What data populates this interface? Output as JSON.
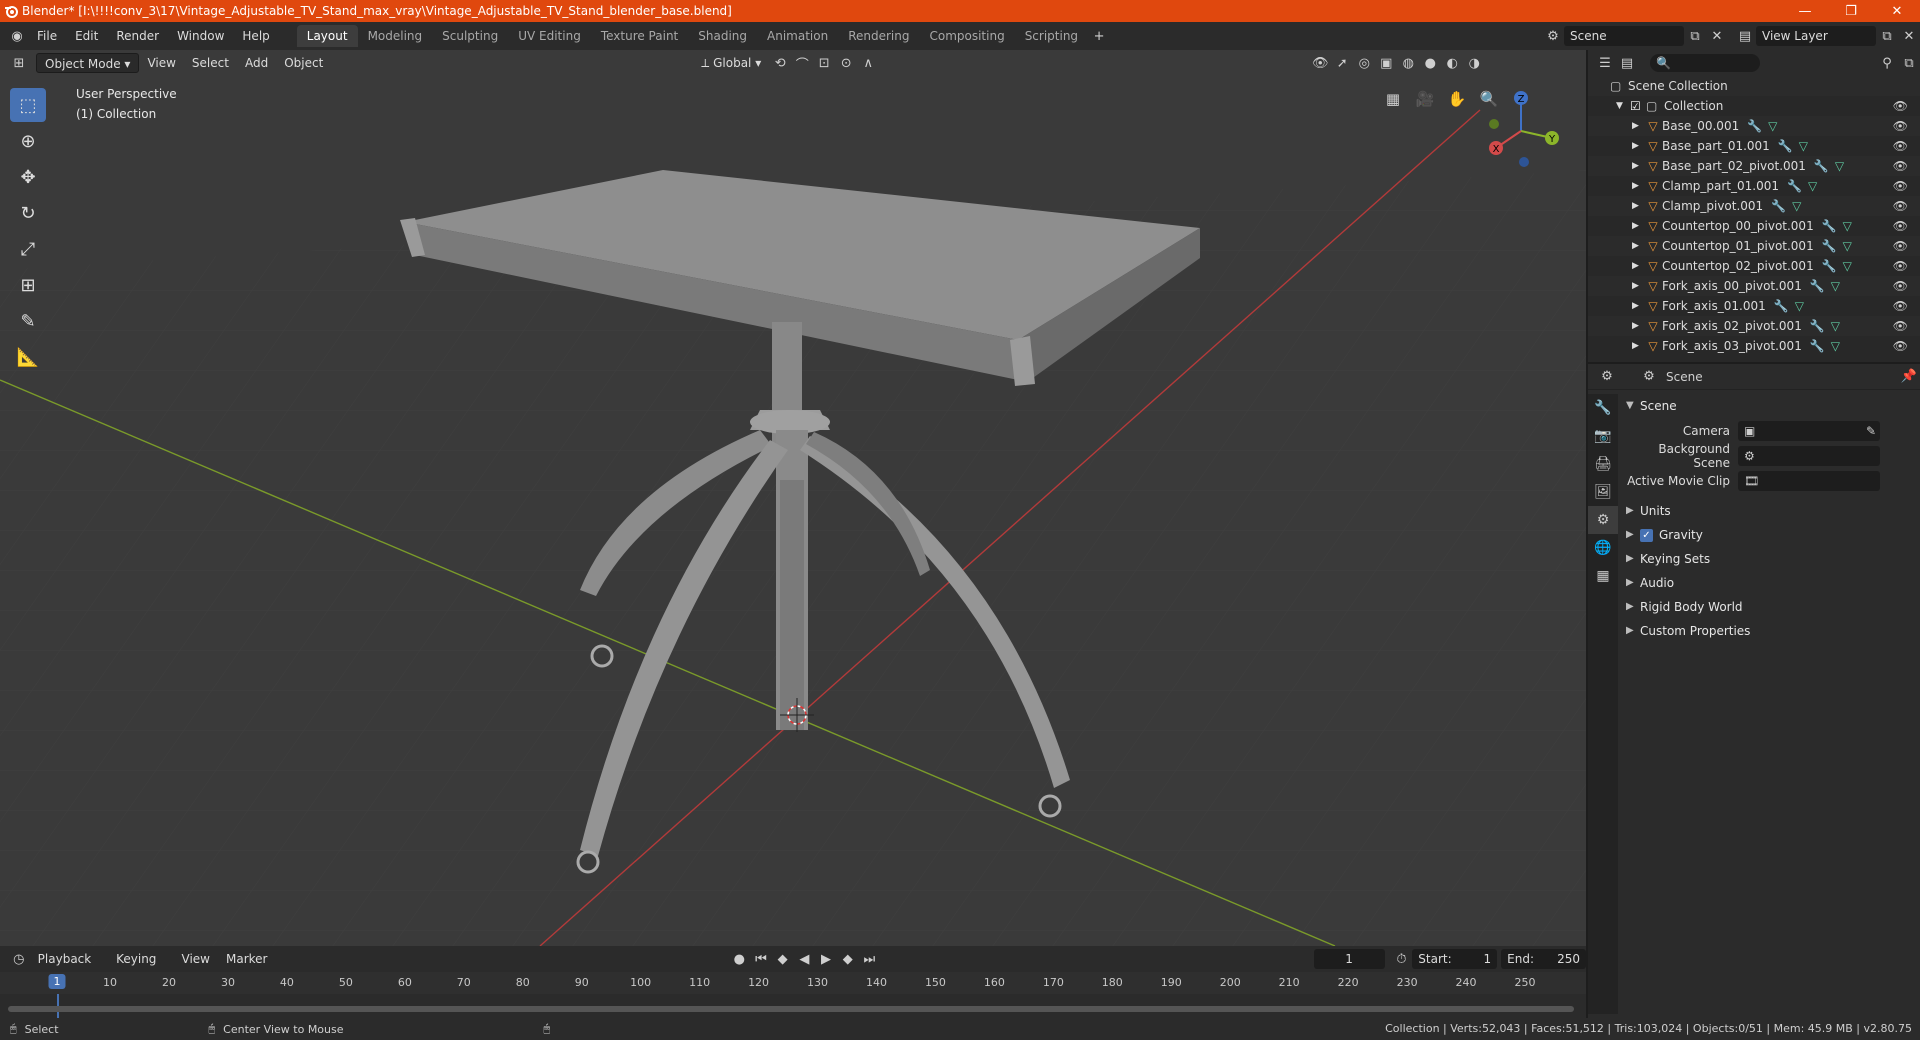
{
  "window": {
    "title": "Blender* [I:\\!!!!conv_3\\17\\Vintage_Adjustable_TV_Stand_max_vray\\Vintage_Adjustable_TV_Stand_blender_base.blend]"
  },
  "menu": [
    "File",
    "Edit",
    "Render",
    "Window",
    "Help"
  ],
  "workspaces": [
    "Layout",
    "Modeling",
    "Sculpting",
    "UV Editing",
    "Texture Paint",
    "Shading",
    "Animation",
    "Rendering",
    "Compositing",
    "Scripting"
  ],
  "active_workspace": "Layout",
  "scene_field": "Scene",
  "view_layer_field": "View Layer",
  "viewport": {
    "mode": "Object Mode",
    "menus": [
      "View",
      "Select",
      "Add",
      "Object"
    ],
    "transform_orientation": "Global",
    "info_line1": "User Perspective",
    "info_line2": "(1) Collection",
    "gizmo": {
      "x": "X",
      "y": "Y",
      "z": "Z"
    }
  },
  "outliner": {
    "scene_collection": "Scene Collection",
    "collection": "Collection",
    "objects": [
      "Base_00.001",
      "Base_part_01.001",
      "Base_part_02_pivot.001",
      "Clamp_part_01.001",
      "Clamp_pivot.001",
      "Countertop_00_pivot.001",
      "Countertop_01_pivot.001",
      "Countertop_02_pivot.001",
      "Fork_axis_00_pivot.001",
      "Fork_axis_01.001",
      "Fork_axis_02_pivot.001",
      "Fork_axis_03_pivot.001"
    ]
  },
  "properties": {
    "header": "Scene",
    "panel": "Scene",
    "fields": [
      {
        "label": "Camera",
        "value": ""
      },
      {
        "label": "Background Scene",
        "value": ""
      },
      {
        "label": "Active Movie Clip",
        "value": ""
      }
    ],
    "subpanels": [
      "Units",
      "Gravity",
      "Keying Sets",
      "Audio",
      "Rigid Body World",
      "Custom Properties"
    ],
    "gravity_checked": true
  },
  "timeline": {
    "menus": [
      "Playback",
      "Keying",
      "View",
      "Marker"
    ],
    "current_frame": "1",
    "start_label": "Start:",
    "start": "1",
    "end_label": "End:",
    "end": "250",
    "ticks": [
      "1",
      "10",
      "20",
      "30",
      "40",
      "50",
      "60",
      "70",
      "80",
      "90",
      "100",
      "110",
      "120",
      "130",
      "140",
      "150",
      "160",
      "170",
      "180",
      "190",
      "200",
      "210",
      "220",
      "230",
      "240",
      "250"
    ]
  },
  "status": {
    "select": "Select",
    "center_view": "Center View to Mouse",
    "stats": "Collection | Verts:52,043 | Faces:51,512 | Tris:103,024 | Objects:0/51 | Mem: 45.9 MB | v2.80.75"
  },
  "colors": {
    "title_bar": "#e0480e",
    "accent": "#4772b3",
    "object_icon": "#e8963a"
  }
}
